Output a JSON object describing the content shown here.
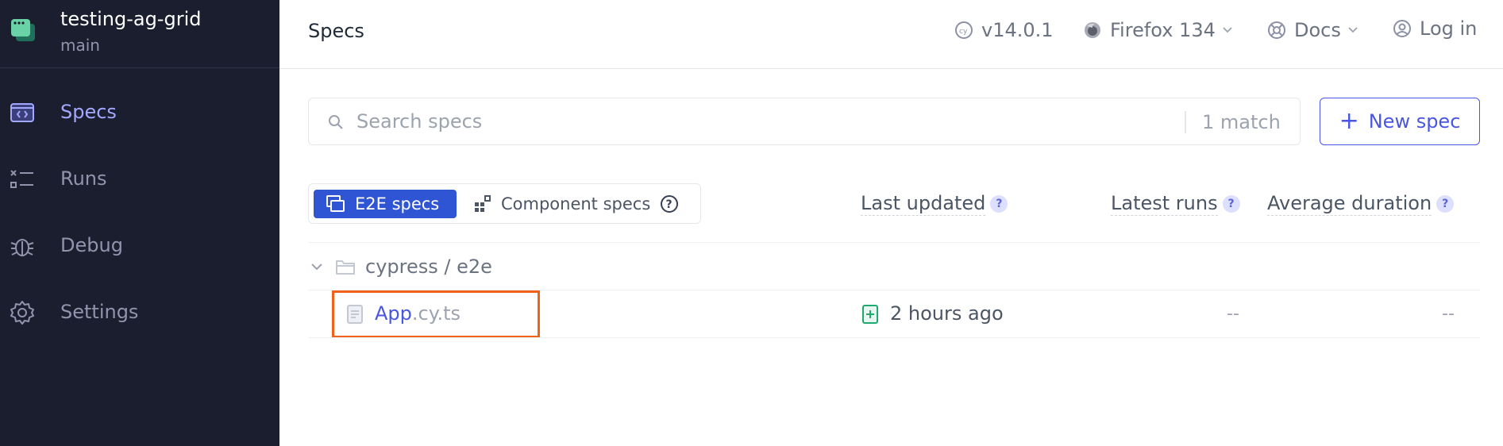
{
  "project": {
    "name": "testing-ag-grid",
    "branch": "main"
  },
  "sidebar": {
    "items": [
      {
        "label": "Specs",
        "icon": "specs-icon",
        "active": true
      },
      {
        "label": "Runs",
        "icon": "runs-icon",
        "active": false
      },
      {
        "label": "Debug",
        "icon": "bug-icon",
        "active": false
      },
      {
        "label": "Settings",
        "icon": "gear-icon",
        "active": false
      }
    ]
  },
  "header": {
    "title": "Specs",
    "version": "v14.0.1",
    "browser": "Firefox 134",
    "docs": "Docs",
    "login": "Log in"
  },
  "search": {
    "placeholder": "Search specs",
    "value": "",
    "match_count": "1 match"
  },
  "new_spec_label": "New spec",
  "toggle": {
    "e2e": "E2E specs",
    "component": "Component specs"
  },
  "columns": {
    "last_updated": "Last updated",
    "latest_runs": "Latest runs",
    "avg_duration": "Average duration"
  },
  "folder": {
    "path": "cypress / e2e"
  },
  "spec": {
    "base": "App",
    "ext": ".cy.ts",
    "last_updated": "2 hours ago",
    "latest_runs": "--",
    "avg_duration": "--"
  },
  "colors": {
    "sidebar_bg": "#1b1e2e",
    "accent": "#4956e3",
    "active_nav": "#a3a8ff",
    "highlight": "#f2611a",
    "toggle_active": "#2f55d4",
    "updated_icon": "#1fa971"
  }
}
